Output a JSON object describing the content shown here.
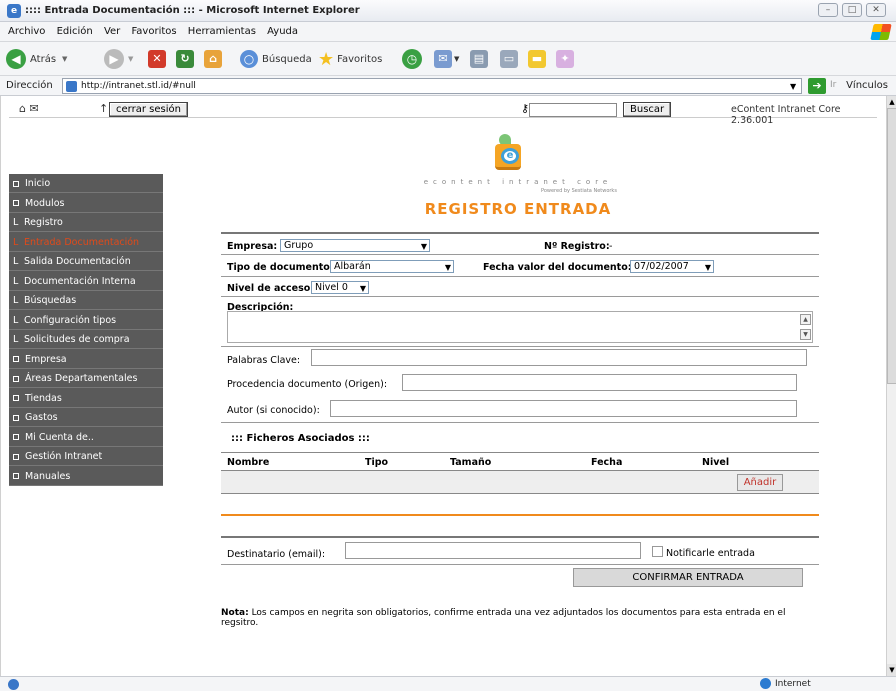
{
  "window": {
    "title": ":::: Entrada Documentación ::: - Microsoft Internet Explorer",
    "menu": [
      "Archivo",
      "Edición",
      "Ver",
      "Favoritos",
      "Herramientas",
      "Ayuda"
    ],
    "toolbar": {
      "back": "Atrás",
      "search": "Búsqueda",
      "favorites": "Favoritos"
    },
    "address_label": "Dirección",
    "url": "http://intranet.stl.id/#null",
    "links_label": "Vínculos",
    "status_zone": "Internet"
  },
  "top": {
    "logout": "cerrar sesión",
    "search_button": "Buscar",
    "search_value": "",
    "version": "eContent Intranet Core 2.36.001"
  },
  "brand": {
    "tagline": "econtent intranet core",
    "powered": "Powered by Sestiata Networks"
  },
  "sidebar": {
    "items": [
      {
        "label": "Inicio",
        "marker": "box"
      },
      {
        "label": "Modulos",
        "marker": "box"
      },
      {
        "label": "Registro",
        "marker": "L"
      },
      {
        "label": "Entrada Documentación",
        "marker": "L"
      },
      {
        "label": "Salida Documentación",
        "marker": "L"
      },
      {
        "label": "Documentación Interna",
        "marker": "L"
      },
      {
        "label": "Búsquedas",
        "marker": "L"
      },
      {
        "label": "Configuración tipos",
        "marker": "L"
      },
      {
        "label": "Solicitudes de compra",
        "marker": "L"
      },
      {
        "label": "Empresa",
        "marker": "box"
      },
      {
        "label": "Áreas Departamentales",
        "marker": "box"
      },
      {
        "label": "Tiendas",
        "marker": "box"
      },
      {
        "label": "Gastos",
        "marker": "box"
      },
      {
        "label": "Mi Cuenta de..",
        "marker": "box"
      },
      {
        "label": "Gestión Intranet",
        "marker": "box"
      },
      {
        "label": "Manuales",
        "marker": "box"
      }
    ],
    "selected_index": 3
  },
  "page": {
    "title": "REGISTRO ENTRADA"
  },
  "form": {
    "empresa_label": "Empresa:",
    "empresa_value": "Grupo",
    "registro_label": "Nº Registro:",
    "registro_value": "-",
    "tipo_label": "Tipo de documento:",
    "tipo_value": "Albarán",
    "fecha_label": "Fecha valor del documento:",
    "fecha_value": "07/02/2007",
    "nivel_label": "Nivel de acceso",
    "nivel_value": "Nivel 0",
    "descripcion_label": "Descripción:",
    "palabras_label": "Palabras Clave:",
    "procedencia_label": "Procedencia documento (Origen):",
    "autor_label": "Autor (si conocido):"
  },
  "files": {
    "title": "::: Ficheros Asociados :::",
    "columns": [
      "Nombre",
      "Tipo",
      "Tamaño",
      "Fecha",
      "Nivel"
    ],
    "add_button": "Añadir"
  },
  "recipient": {
    "label": "Destinatario (email):",
    "notify_label": "Notificarle entrada",
    "notify_checked": false,
    "confirm_button": "CONFIRMAR ENTRADA"
  },
  "note": {
    "bold": "Nota:",
    "text": " Los campos en negrita son obligatorios, confirme entrada una vez adjuntados los documentos para esta entrada en el regsitro."
  }
}
